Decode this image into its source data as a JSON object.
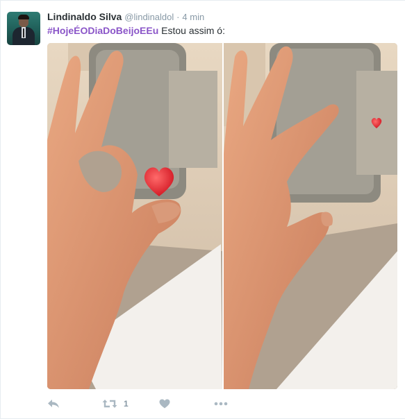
{
  "tweet": {
    "author_name": "Lindinaldo Silva",
    "username": "@lindinaldol",
    "separator": "·",
    "time": "4 min",
    "hashtag": "#HojeÉODiaDoBeijoEEu",
    "text": "Estou assim ó:",
    "retweet_count": "1"
  },
  "icons": {
    "reply": "reply-icon",
    "retweet": "retweet-icon",
    "like": "heart-icon",
    "more": "more-dots-icon"
  },
  "colors": {
    "hashtag": "#8a55c8",
    "name": "#292f33",
    "meta": "#8899a6",
    "action": "#aab8c2",
    "emoji_heart": "#e8232f"
  }
}
